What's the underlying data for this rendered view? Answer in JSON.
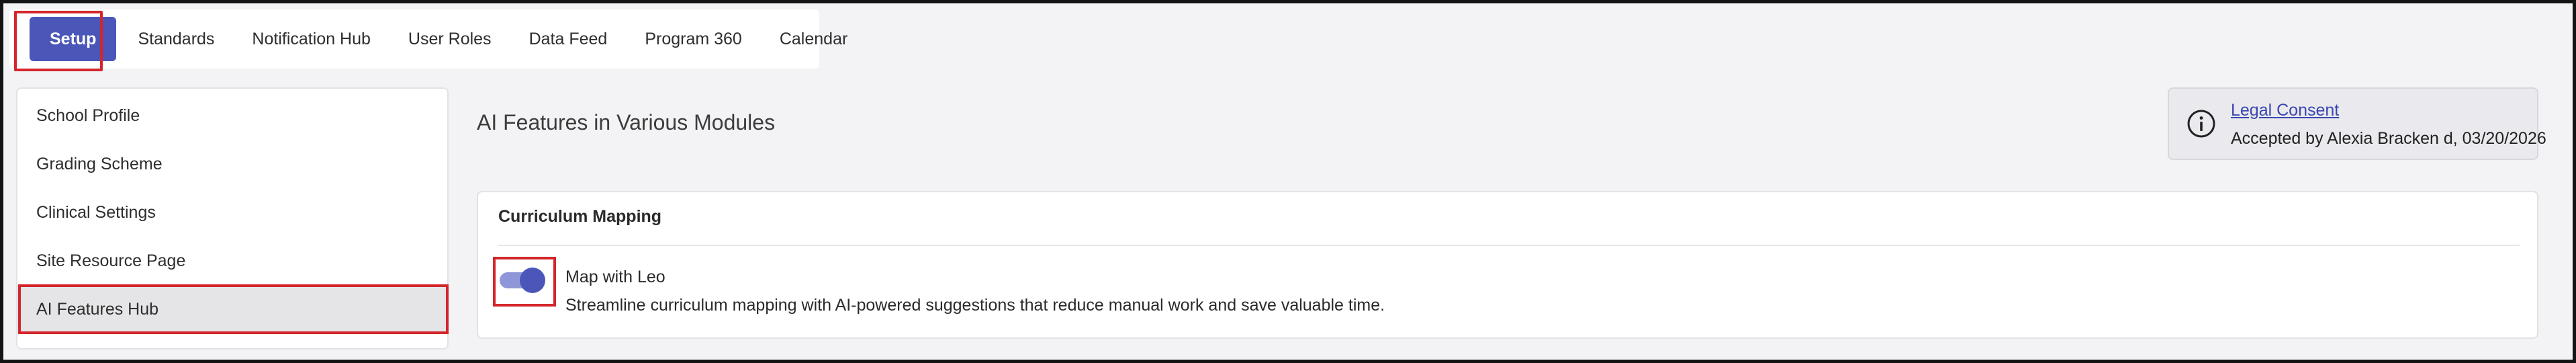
{
  "tabs": [
    {
      "label": "Setup",
      "active": true
    },
    {
      "label": "Standards",
      "active": false
    },
    {
      "label": "Notification Hub",
      "active": false
    },
    {
      "label": "User Roles",
      "active": false
    },
    {
      "label": "Data Feed",
      "active": false
    },
    {
      "label": "Program 360",
      "active": false
    },
    {
      "label": "Calendar",
      "active": false
    }
  ],
  "sidebar": {
    "items": [
      {
        "label": "School Profile",
        "active": false
      },
      {
        "label": "Grading Scheme",
        "active": false
      },
      {
        "label": "Clinical Settings",
        "active": false
      },
      {
        "label": "Site Resource Page",
        "active": false
      },
      {
        "label": "AI Features Hub",
        "active": true
      }
    ]
  },
  "main": {
    "title": "AI Features in Various Modules",
    "consent": {
      "icon": "info-icon",
      "link_label": "Legal Consent",
      "accepted_text": "Accepted by Alexia Bracken d, 03/20/2026"
    },
    "modules": [
      {
        "title": "Curriculum Mapping",
        "features": [
          {
            "name": "Map with Leo",
            "description": "Streamline curriculum mapping with AI-powered suggestions that reduce manual work and save valuable time.",
            "enabled": true
          }
        ]
      }
    ]
  },
  "colors": {
    "accent": "#4a56b8",
    "toggle_track": "#8f97d8",
    "highlight": "#d3262b",
    "link": "#3a47b0"
  }
}
